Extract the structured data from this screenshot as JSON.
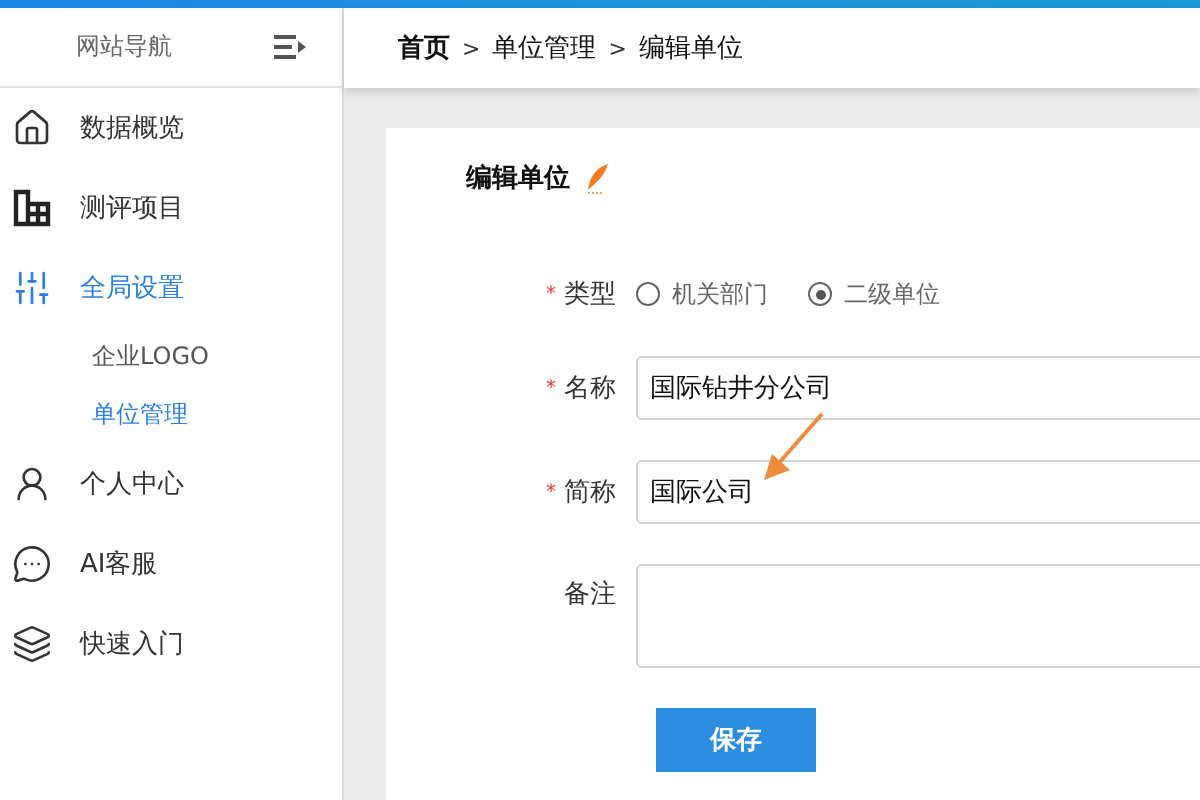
{
  "sidebar": {
    "title": "网站导航",
    "items": [
      {
        "kind": "home",
        "label": "数据概览",
        "selected": false
      },
      {
        "kind": "grid",
        "label": "测评项目",
        "selected": false
      },
      {
        "kind": "sliders",
        "label": "全局设置",
        "selected": true,
        "children": [
          {
            "label": "企业LOGO",
            "selected": false
          },
          {
            "label": "单位管理",
            "selected": true
          }
        ]
      },
      {
        "kind": "user",
        "label": "个人中心",
        "selected": false
      },
      {
        "kind": "chat",
        "label": "AI客服",
        "selected": false
      },
      {
        "kind": "layers",
        "label": "快速入门",
        "selected": false
      }
    ]
  },
  "breadcrumb": [
    "首页",
    "单位管理",
    "编辑单位"
  ],
  "breadcrumb_separator": ">",
  "form": {
    "title": "编辑单位",
    "type_field": {
      "label": "类型",
      "required": true,
      "options": [
        {
          "label": "机关部门",
          "selected": false
        },
        {
          "label": "二级单位",
          "selected": true
        }
      ]
    },
    "fields": [
      {
        "kind": "input",
        "label": "名称",
        "required": true,
        "value": "国际钻井分公司"
      },
      {
        "kind": "input",
        "label": "简称",
        "required": true,
        "value": "国际公司"
      },
      {
        "kind": "textarea",
        "label": "备注",
        "required": false
      }
    ],
    "required_mark": "*",
    "submit": "保存"
  }
}
